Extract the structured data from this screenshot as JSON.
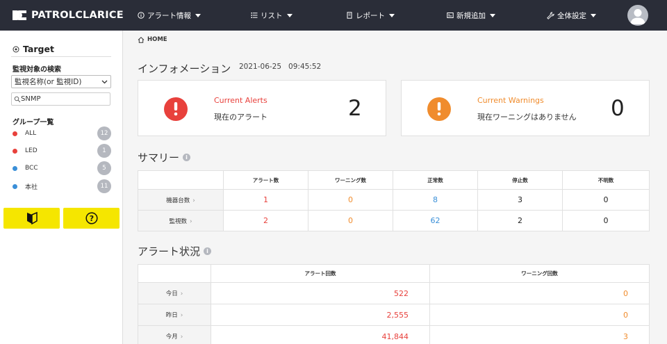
{
  "brand": {
    "name": "PATROLCLARICE"
  },
  "nav": {
    "items": [
      {
        "label": "アラート情報",
        "icon": "info-circle-icon"
      },
      {
        "label": "リスト",
        "icon": "list-icon"
      },
      {
        "label": "レポート",
        "icon": "report-icon"
      },
      {
        "label": "新規追加",
        "icon": "add-box-icon"
      },
      {
        "label": "全体設定",
        "icon": "wrench-icon"
      }
    ]
  },
  "sidebar": {
    "title": "Target",
    "search_label": "監視対象の検索",
    "select_value": "監視名称(or 監視ID)",
    "search_value": "SNMP",
    "group_label": "グループ一覧",
    "groups": [
      {
        "name": "ALL",
        "count": "12",
        "color": "#e8413c"
      },
      {
        "name": "LED",
        "count": "1",
        "color": "#e8413c"
      },
      {
        "name": "BCC",
        "count": "5",
        "color": "#3a8fd8"
      },
      {
        "name": "本社",
        "count": "11",
        "color": "#3a8fd8"
      }
    ]
  },
  "breadcrumb": {
    "label": "HOME"
  },
  "info": {
    "title": "インフォメーション",
    "date": "2021-06-25",
    "time": "09:45:52"
  },
  "cards": {
    "alerts": {
      "title": "Current Alerts",
      "sub": "現在のアラート",
      "count": "2",
      "color": "#e8413c"
    },
    "warnings": {
      "title": "Current Warnings",
      "sub": "現在ワーニングはありません",
      "count": "0",
      "color": "#f08c2d"
    }
  },
  "summary": {
    "title": "サマリー",
    "headers": [
      "アラート数",
      "ワーニング数",
      "正常数",
      "停止数",
      "不明数"
    ],
    "rows": [
      {
        "label": "機器台数",
        "values": [
          "1",
          "0",
          "8",
          "3",
          "0"
        ]
      },
      {
        "label": "監視数",
        "values": [
          "2",
          "0",
          "62",
          "2",
          "0"
        ]
      }
    ]
  },
  "alert_status": {
    "title": "アラート状況",
    "headers": [
      "アラート回数",
      "ワーニング回数"
    ],
    "rows": [
      {
        "label": "今日",
        "alerts": "522",
        "warnings": "0"
      },
      {
        "label": "昨日",
        "alerts": "2,555",
        "warnings": "0"
      },
      {
        "label": "今月",
        "alerts": "41,844",
        "warnings": "3"
      }
    ]
  }
}
